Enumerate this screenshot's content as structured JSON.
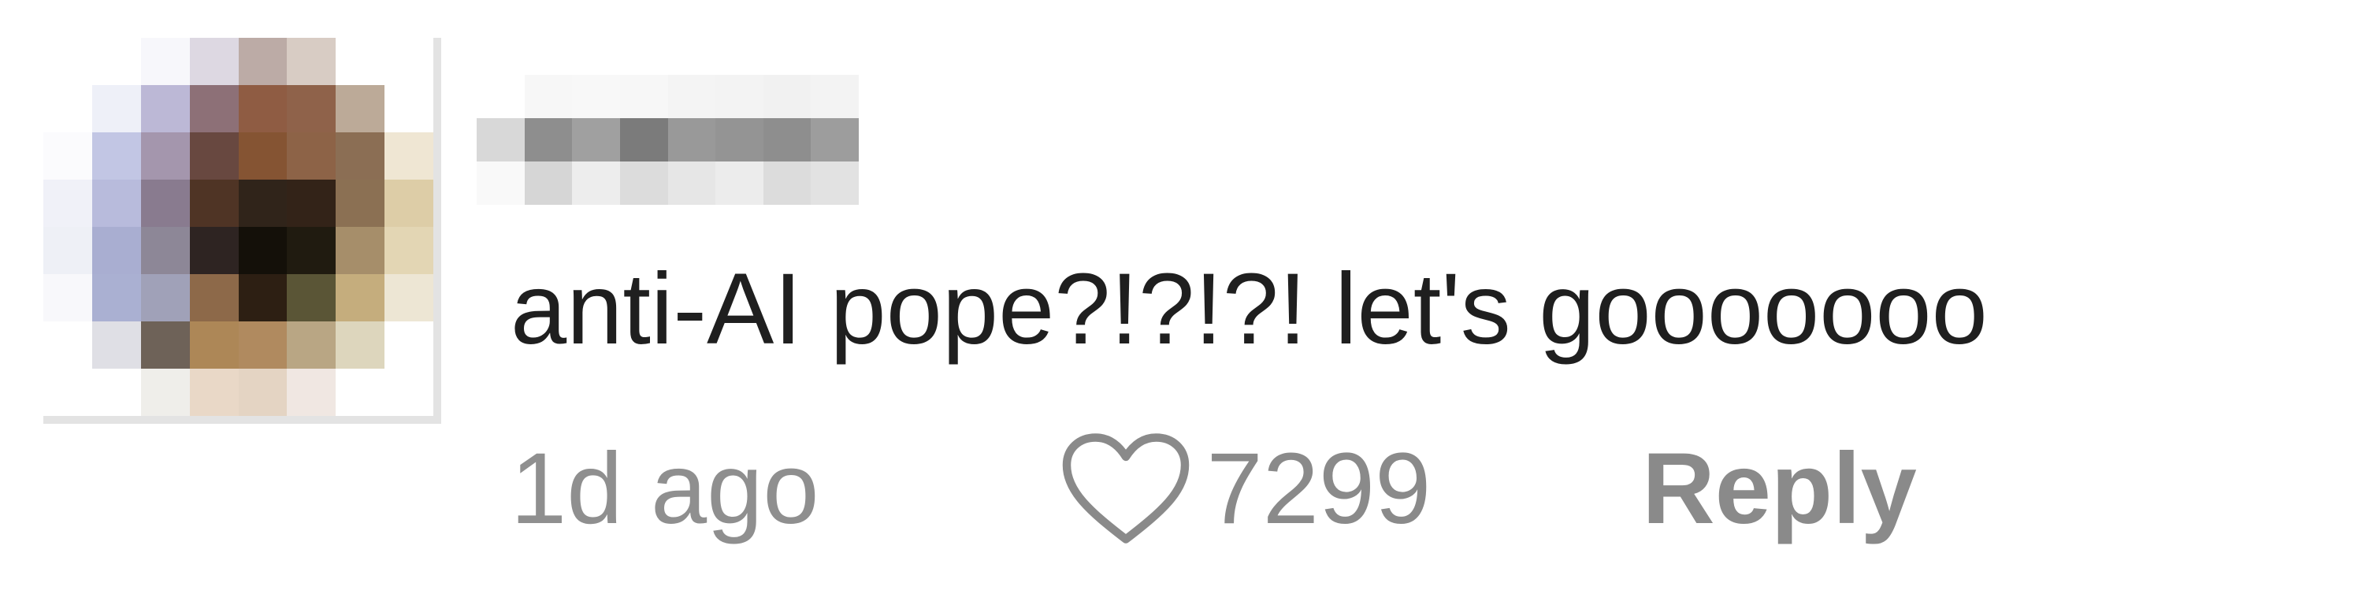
{
  "comment": {
    "text": "anti-AI pope?!?!?! let's gooooooo",
    "timestamp": "1d ago",
    "like_count": "7299",
    "reply_label": "Reply",
    "like_icon": "heart-outline-icon"
  },
  "colors": {
    "text": "#1f1f1f",
    "meta": "#8a8a8a",
    "background": "#ffffff"
  }
}
